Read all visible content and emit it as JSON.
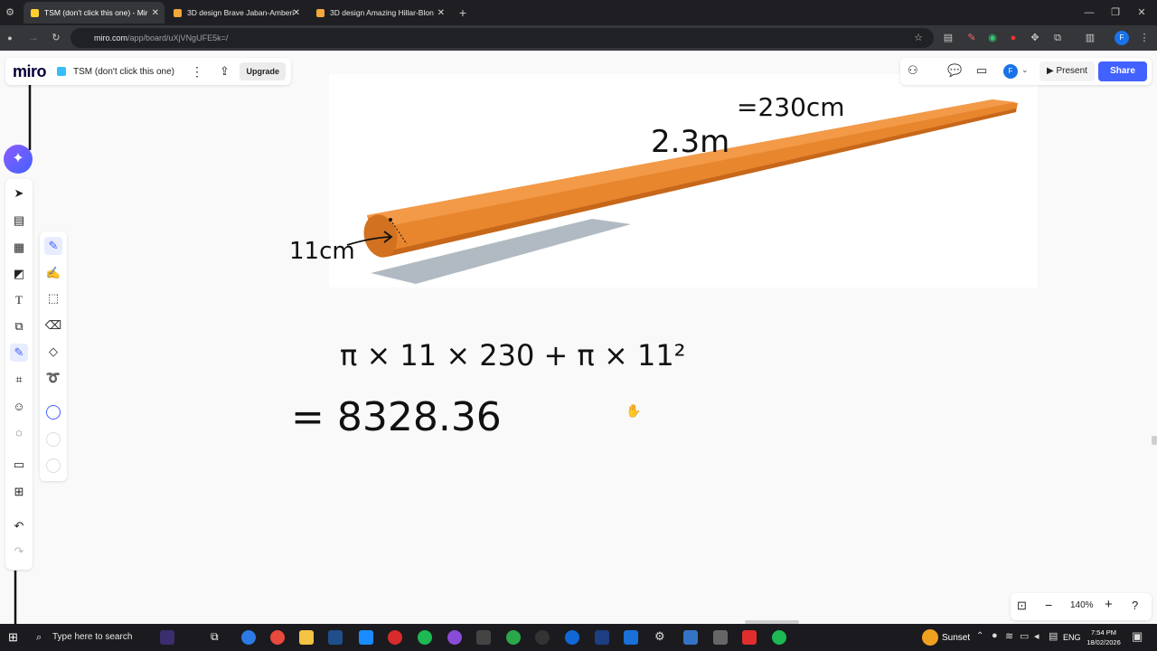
{
  "browser": {
    "tabs": [
      {
        "title": "TSM (don't click this one) - Mir",
        "active": true
      },
      {
        "title": "3D design Brave Jaban-Amberi",
        "active": false
      },
      {
        "title": "3D design Amazing Hillar-Blon",
        "active": false
      }
    ],
    "url_host": "miro.com",
    "url_path": "/app/board/uXjVNgUFE5k=/"
  },
  "miro": {
    "logo": "miro",
    "board_title": "TSM (don't click this one)",
    "upgrade_label": "Upgrade",
    "present_label": "Present",
    "share_label": "Share",
    "avatar_letter": "F",
    "zoom_level": "140%"
  },
  "canvas": {
    "length_label": "2.3m",
    "length_cm_label": "=230cm",
    "radius_label": "11cm",
    "formula": "π × 11 × 230 + π × 11²",
    "result": "= 8328.36"
  },
  "taskbar": {
    "search_placeholder": "Type here to search",
    "weather": "Sunset",
    "language": "ENG",
    "time": "7:54 PM",
    "date": "18/02/2026"
  },
  "colors": {
    "accent": "#4262ff",
    "tube": "#e8862e",
    "tube_dark": "#b85a12",
    "shadow": "#a9b3bd",
    "tab_active": "#35363a"
  }
}
